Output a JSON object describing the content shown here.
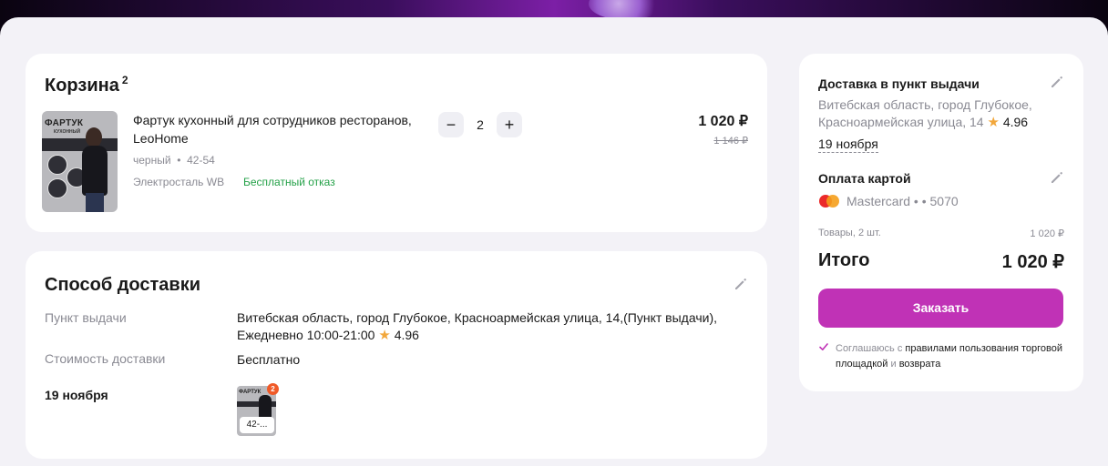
{
  "cart": {
    "title": "Корзина",
    "count": "2",
    "item": {
      "image_title": "ФАРТУК",
      "image_subtitle": "КУХОННЫЙ",
      "name": "Фартук кухонный для сотрудников ресторанов, LeoHome",
      "color": "черный",
      "size": "42-54",
      "warehouse": "Электросталь WB",
      "return_policy": "Бесплатный отказ",
      "quantity": "2",
      "price": "1 020 ₽",
      "old_price": "1 146 ₽"
    }
  },
  "delivery": {
    "title": "Способ доставки",
    "pickup_label": "Пункт выдачи",
    "pickup_value_line1": "Витебская область, город Глубокое, Красноармейская улица, 14,(Пункт выдачи),",
    "pickup_value_line2": "Ежедневно 10:00-21:00",
    "pickup_rating": "4.96",
    "cost_label": "Стоимость доставки",
    "cost_value": "Бесплатно",
    "date": "19 ноября",
    "thumb_size": "42-...",
    "thumb_count": "2"
  },
  "summary": {
    "delivery_title": "Доставка в пункт выдачи",
    "address_line1": "Витебская область, город Глубокое,",
    "address_line2": "Красноармейская улица, 14",
    "rating": "4.96",
    "date": "19 ноября",
    "payment_title": "Оплата картой",
    "card_name": "Mastercard",
    "card_dots": "• •",
    "card_last4": "5070",
    "goods_label": "Товары, 2 шт.",
    "goods_value": "1 020 ₽",
    "total_label": "Итого",
    "total_value": "1 020 ₽",
    "order_button": "Заказать",
    "agree_prefix": "Соглашаюсь с",
    "agree_link1": "правилами пользования торговой площадкой",
    "agree_mid": "и",
    "agree_link2": "возврата"
  },
  "colors": {
    "accent": "#c032b6",
    "success": "#24a148",
    "star": "#f2a73b",
    "badge": "#f05a28"
  }
}
